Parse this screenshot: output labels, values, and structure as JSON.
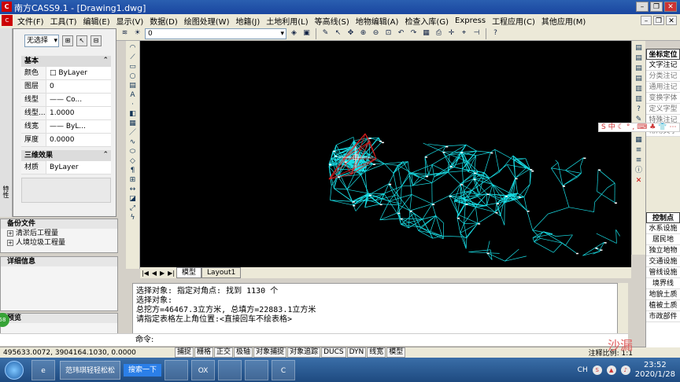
{
  "window": {
    "app_icon": "C",
    "title": "南方CASS9.1 - [Drawing1.dwg]",
    "buttons": [
      "–",
      "❐",
      "✕"
    ]
  },
  "menu": [
    "文件(F)",
    "工具(T)",
    "编辑(E)",
    "显示(V)",
    "数据(D)",
    "绘图处理(W)",
    "地籍(J)",
    "土地利用(L)",
    "等高线(S)",
    "地物编辑(A)",
    "检查入库(G)",
    "Express",
    "工程应用(C)",
    "其他应用(M)"
  ],
  "toolbar": {
    "layer_value": "0"
  },
  "properties": {
    "selection": "无选择",
    "basic_title": "基本",
    "rows": [
      {
        "k": "颜色",
        "v": "□ ByLayer"
      },
      {
        "k": "图层",
        "v": "0"
      },
      {
        "k": "线型",
        "v": "—— Co..."
      },
      {
        "k": "线型...",
        "v": "1.0000"
      },
      {
        "k": "线宽",
        "v": "—— ByL..."
      },
      {
        "k": "厚度",
        "v": "0.0000"
      }
    ],
    "effects_title": "三维效果",
    "effects_rows": [
      {
        "k": "材质",
        "v": "ByLayer"
      }
    ]
  },
  "side_strip_caption": "特性",
  "backup": {
    "title": "备份文件",
    "items": [
      "清淤后工程量",
      "人境垃圾工程量"
    ]
  },
  "details": {
    "title": "详细信息"
  },
  "preview": {
    "title": "预览"
  },
  "tabs": {
    "model": "模型",
    "layout": "Layout1"
  },
  "command": {
    "history": [
      "选择对象: 指定对角点: 找到 1130 个",
      "选择对象:",
      "总挖方=46467.3立方米, 总填方=22883.1立方米",
      "请指定表格左上角位置:<直接回车不绘表格>"
    ],
    "prompt": "命令:"
  },
  "status": {
    "coords": "495633.0072, 3904164.1030, 0.0000",
    "buttons": [
      "捕捉",
      "栅格",
      "正交",
      "极轴",
      "对象捕捉",
      "对象追踪",
      "DUCS",
      "DYN",
      "线宽",
      "模型"
    ],
    "scale": "注释比例: 1:1"
  },
  "right_menu": {
    "top_items": [
      {
        "label": "坐标定位",
        "style": "head"
      },
      {
        "label": "文字注记",
        "style": ""
      },
      {
        "label": "分类注记",
        "style": "gray"
      },
      {
        "label": "通用注记",
        "style": "gray"
      },
      {
        "label": "变换字体",
        "style": "gray"
      },
      {
        "label": "定义字型",
        "style": "gray"
      },
      {
        "label": "特殊注记",
        "style": "gray"
      },
      {
        "label": "常用文字",
        "style": "gray"
      }
    ],
    "bottom_items": [
      "控制点",
      "水系设施",
      "居民地",
      "独立地物",
      "交通设施",
      "管线设施",
      "境界线",
      "地貌土质",
      "植被土质",
      "市政部件"
    ]
  },
  "ime_bar": [
    "S",
    "中",
    "☾",
    "°",
    ",",
    "⌨",
    "♣",
    "👕",
    "⋯"
  ],
  "watermark": "沙漏",
  "taskbar": {
    "task_label": "范玮琪轻轻松松",
    "search_label": "搜索一下",
    "app_labels": [
      "e",
      "",
      "OX",
      "",
      "",
      "C"
    ],
    "tray_lang": "CH",
    "time": "23:52",
    "date": "2020/1/28"
  },
  "green_badge": "58"
}
